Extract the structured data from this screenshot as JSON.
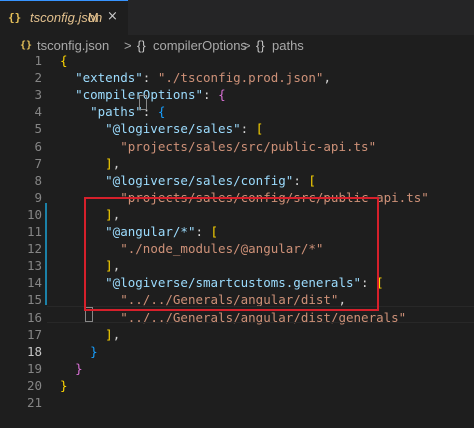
{
  "tab": {
    "icon": "{}",
    "title": "tsconfig.json",
    "badge": "M",
    "close": "×"
  },
  "breadcrumb": {
    "file_icon": "{}",
    "file": "tsconfig.json",
    "sep1": ">",
    "node_icon_1": "{}",
    "node1": "compilerOptions",
    "sep2": ">",
    "node_icon_2": "{}",
    "node2": "paths"
  },
  "lines": [
    {
      "n": "1",
      "indent": "",
      "tokens": [
        {
          "t": "{",
          "c": "b1"
        }
      ]
    },
    {
      "n": "2",
      "indent": "  ",
      "tokens": [
        {
          "t": "\"extends\"",
          "c": "k"
        },
        {
          "t": ": ",
          "c": "p"
        },
        {
          "t": "\"./tsconfig.prod.json\"",
          "c": "s"
        },
        {
          "t": ",",
          "c": "p"
        }
      ]
    },
    {
      "n": "3",
      "indent": "  ",
      "tokens": [
        {
          "t": "\"compilerOptions\"",
          "c": "k"
        },
        {
          "t": ": ",
          "c": "p"
        },
        {
          "t": "{",
          "c": "b2"
        }
      ]
    },
    {
      "n": "4",
      "indent": "    ",
      "tokens": [
        {
          "t": "\"paths\"",
          "c": "k"
        },
        {
          "t": ": ",
          "c": "p"
        },
        {
          "t": "{",
          "c": "b3"
        }
      ]
    },
    {
      "n": "5",
      "indent": "      ",
      "tokens": [
        {
          "t": "\"@logiverse/sales\"",
          "c": "k"
        },
        {
          "t": ": ",
          "c": "p"
        },
        {
          "t": "[",
          "c": "b1"
        }
      ]
    },
    {
      "n": "6",
      "indent": "        ",
      "tokens": [
        {
          "t": "\"projects/sales/src/public-api.ts\"",
          "c": "s"
        }
      ]
    },
    {
      "n": "7",
      "indent": "      ",
      "tokens": [
        {
          "t": "]",
          "c": "b1"
        },
        {
          "t": ",",
          "c": "p"
        }
      ]
    },
    {
      "n": "8",
      "indent": "      ",
      "tokens": [
        {
          "t": "\"@logiverse/sales/config\"",
          "c": "k"
        },
        {
          "t": ": ",
          "c": "p"
        },
        {
          "t": "[",
          "c": "b1"
        }
      ]
    },
    {
      "n": "9",
      "indent": "        ",
      "tokens": [
        {
          "t": "\"projects/sales/config/src/public-api.ts\"",
          "c": "s"
        }
      ]
    },
    {
      "n": "10",
      "indent": "      ",
      "tokens": [
        {
          "t": "]",
          "c": "b1"
        },
        {
          "t": ",",
          "c": "p"
        }
      ]
    },
    {
      "n": "11",
      "indent": "      ",
      "tokens": [
        {
          "t": "\"@angular/*\"",
          "c": "k"
        },
        {
          "t": ": ",
          "c": "p"
        },
        {
          "t": "[",
          "c": "b1"
        }
      ]
    },
    {
      "n": "12",
      "indent": "        ",
      "tokens": [
        {
          "t": "\"./node_modules/@angular/*\"",
          "c": "s"
        }
      ]
    },
    {
      "n": "13",
      "indent": "      ",
      "tokens": [
        {
          "t": "]",
          "c": "b1"
        },
        {
          "t": ",",
          "c": "p"
        }
      ]
    },
    {
      "n": "14",
      "indent": "      ",
      "tokens": [
        {
          "t": "\"@logiverse/smartcustoms.generals\"",
          "c": "k"
        },
        {
          "t": ": ",
          "c": "p"
        },
        {
          "t": "[",
          "c": "b1"
        }
      ]
    },
    {
      "n": "15",
      "indent": "        ",
      "tokens": [
        {
          "t": "\"../../Generals/angular/dist\"",
          "c": "s"
        },
        {
          "t": ",",
          "c": "p"
        }
      ]
    },
    {
      "n": "16",
      "indent": "        ",
      "tokens": [
        {
          "t": "\"../../Generals/angular/dist/generals\"",
          "c": "s"
        }
      ]
    },
    {
      "n": "17",
      "indent": "      ",
      "tokens": [
        {
          "t": "]",
          "c": "b1"
        },
        {
          "t": ",",
          "c": "p"
        }
      ]
    },
    {
      "n": "18",
      "indent": "    ",
      "tokens": [
        {
          "t": "}",
          "c": "b3"
        }
      ]
    },
    {
      "n": "19",
      "indent": "  ",
      "tokens": [
        {
          "t": "}",
          "c": "b2"
        }
      ]
    },
    {
      "n": "20",
      "indent": "",
      "tokens": [
        {
          "t": "}",
          "c": "b1"
        }
      ]
    },
    {
      "n": "21",
      "indent": "",
      "tokens": []
    }
  ],
  "active_line": "18"
}
